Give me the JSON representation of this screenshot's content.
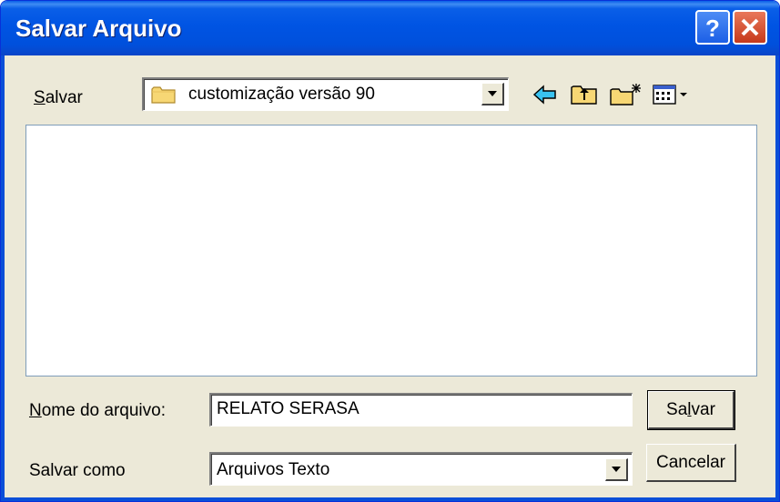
{
  "window": {
    "title": "Salvar Arquivo",
    "help_label": "?",
    "close_label": "X"
  },
  "save_in": {
    "label_underlined": "S",
    "label_rest": "alvar",
    "value": "customização versão 90",
    "folder_icon": "folder-icon"
  },
  "toolbar": {
    "back_icon": "back-arrow-icon",
    "up_icon": "up-folder-icon",
    "new_folder_icon": "new-folder-icon",
    "view_menu_icon": "view-menu-icon"
  },
  "filename": {
    "label_underlined": "N",
    "label_rest": "ome do arquivo:",
    "value": "RELATO SERASA"
  },
  "filetype": {
    "label": "Salvar como",
    "value": "Arquivos Texto"
  },
  "buttons": {
    "save_pre": "Sa",
    "save_underlined": "l",
    "save_post": "var",
    "cancel": "Cancelar"
  },
  "colors": {
    "titlebar": "#0054e3",
    "window_bg": "#ece9d8",
    "close_button": "#c6391b"
  }
}
